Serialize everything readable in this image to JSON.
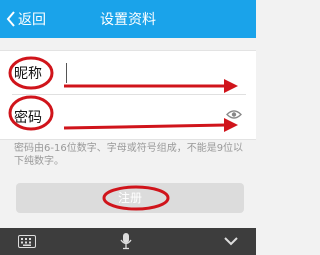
{
  "header": {
    "back_label": "返回",
    "title": "设置资料"
  },
  "form": {
    "nickname_label": "昵称",
    "nickname_value": "",
    "password_label": "密码",
    "password_value": ""
  },
  "hint_text": "密码由6-16位数字、字母或符号组成，不能是9位以下纯数字。",
  "register_label": "注册",
  "colors": {
    "header_bg": "#1aa3ea",
    "annotation_red": "#d0141b",
    "button_disabled": "#dcdcdc",
    "keyboard_bar": "#3d3d3d"
  },
  "icons": {
    "back": "chevron-left-icon",
    "password_visibility": "eye-icon",
    "keyboard": "keyboard-icon",
    "voice": "microphone-icon",
    "hide_keyboard": "chevron-down-icon"
  }
}
